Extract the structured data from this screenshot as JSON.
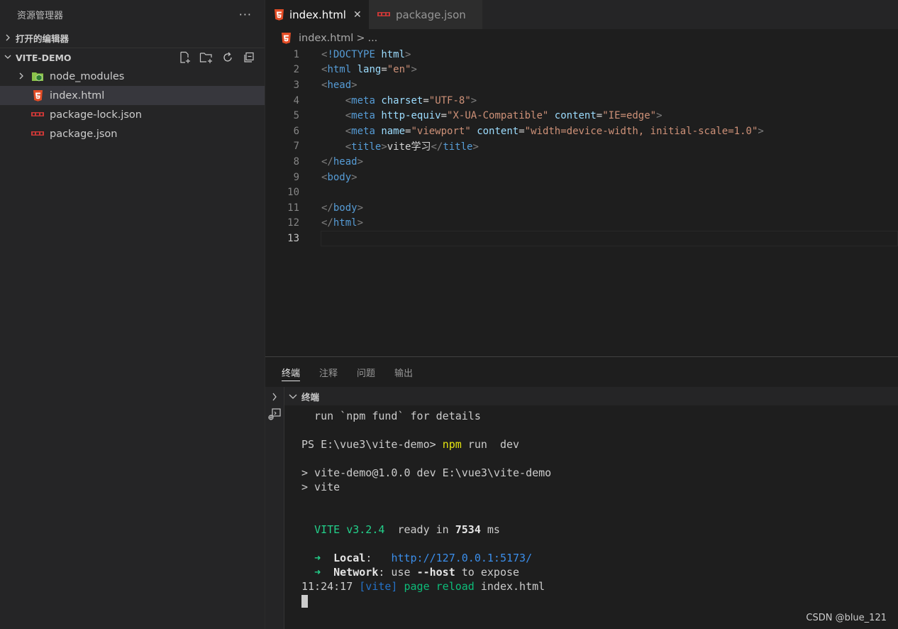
{
  "sidebar": {
    "title": "资源管理器",
    "more": "···",
    "open_editors": "打开的编辑器",
    "project": "VITE-DEMO",
    "items": [
      {
        "label": "node_modules",
        "icon": "node-modules-folder-icon"
      },
      {
        "label": "index.html",
        "icon": "html5-icon"
      },
      {
        "label": "package-lock.json",
        "icon": "npm-icon"
      },
      {
        "label": "package.json",
        "icon": "npm-icon"
      }
    ]
  },
  "editor": {
    "tabs": [
      {
        "label": "index.html",
        "close": "✕"
      },
      {
        "label": "package.json"
      }
    ],
    "breadcrumb": {
      "file": "index.html",
      "sep": ">",
      "more": "..."
    },
    "line_numbers": [
      "1",
      "2",
      "3",
      "4",
      "5",
      "6",
      "7",
      "8",
      "9",
      "10",
      "11",
      "12",
      "13"
    ],
    "lines": [
      [
        [
          "t-br",
          "<"
        ],
        [
          "t-tag",
          "!DOCTYPE"
        ],
        [
          "t-txt",
          " "
        ],
        [
          "t-attr",
          "html"
        ],
        [
          "t-br",
          ">"
        ]
      ],
      [
        [
          "t-br",
          "<"
        ],
        [
          "t-tag",
          "html"
        ],
        [
          "t-txt",
          " "
        ],
        [
          "t-attr",
          "lang"
        ],
        [
          "t-txt",
          "="
        ],
        [
          "t-str",
          "\"en\""
        ],
        [
          "t-br",
          ">"
        ]
      ],
      [
        [
          "t-br",
          "<"
        ],
        [
          "t-tag",
          "head"
        ],
        [
          "t-br",
          ">"
        ]
      ],
      [
        [
          "t-txt",
          "    "
        ],
        [
          "t-br",
          "<"
        ],
        [
          "t-tag",
          "meta"
        ],
        [
          "t-txt",
          " "
        ],
        [
          "t-attr",
          "charset"
        ],
        [
          "t-txt",
          "="
        ],
        [
          "t-str",
          "\"UTF-8\""
        ],
        [
          "t-br",
          ">"
        ]
      ],
      [
        [
          "t-txt",
          "    "
        ],
        [
          "t-br",
          "<"
        ],
        [
          "t-tag",
          "meta"
        ],
        [
          "t-txt",
          " "
        ],
        [
          "t-attr",
          "http-equiv"
        ],
        [
          "t-txt",
          "="
        ],
        [
          "t-str",
          "\"X-UA-Compatible\""
        ],
        [
          "t-txt",
          " "
        ],
        [
          "t-attr",
          "content"
        ],
        [
          "t-txt",
          "="
        ],
        [
          "t-str",
          "\"IE=edge\""
        ],
        [
          "t-br",
          ">"
        ]
      ],
      [
        [
          "t-txt",
          "    "
        ],
        [
          "t-br",
          "<"
        ],
        [
          "t-tag",
          "meta"
        ],
        [
          "t-txt",
          " "
        ],
        [
          "t-attr",
          "name"
        ],
        [
          "t-txt",
          "="
        ],
        [
          "t-str",
          "\"viewport\""
        ],
        [
          "t-txt",
          " "
        ],
        [
          "t-attr",
          "content"
        ],
        [
          "t-txt",
          "="
        ],
        [
          "t-str",
          "\"width=device-width, initial-scale=1.0\""
        ],
        [
          "t-br",
          ">"
        ]
      ],
      [
        [
          "t-txt",
          "    "
        ],
        [
          "t-br",
          "<"
        ],
        [
          "t-tag",
          "title"
        ],
        [
          "t-br",
          ">"
        ],
        [
          "t-txt",
          "vite学习"
        ],
        [
          "t-br",
          "</"
        ],
        [
          "t-tag",
          "title"
        ],
        [
          "t-br",
          ">"
        ]
      ],
      [
        [
          "t-br",
          "</"
        ],
        [
          "t-tag",
          "head"
        ],
        [
          "t-br",
          ">"
        ]
      ],
      [
        [
          "t-br",
          "<"
        ],
        [
          "t-tag",
          "body"
        ],
        [
          "t-br",
          ">"
        ]
      ],
      [],
      [
        [
          "t-br",
          "</"
        ],
        [
          "t-tag",
          "body"
        ],
        [
          "t-br",
          ">"
        ]
      ],
      [
        [
          "t-br",
          "</"
        ],
        [
          "t-tag",
          "html"
        ],
        [
          "t-br",
          ">"
        ]
      ],
      []
    ]
  },
  "panel": {
    "tabs": [
      "终端",
      "注释",
      "问题",
      "输出"
    ],
    "terminal_title": "终端",
    "terminal_lines": [
      [
        [
          "",
          "  run `npm fund` for details"
        ]
      ],
      [],
      [
        [
          "",
          "PS E:\\vue3\\vite-demo> "
        ],
        [
          "c-y",
          "npm"
        ],
        [
          "",
          " run  dev"
        ]
      ],
      [],
      [
        [
          "",
          "> vite-demo@1.0.0 dev E:\\vue3\\vite-demo"
        ]
      ],
      [
        [
          "",
          "> vite"
        ]
      ],
      [],
      [],
      [
        [
          "",
          "  "
        ],
        [
          "c-g",
          "VITE v3.2.4"
        ],
        [
          "",
          "  ready in "
        ],
        [
          "c-w",
          "7534"
        ],
        [
          "",
          " ms"
        ]
      ],
      [],
      [
        [
          "",
          "  "
        ],
        [
          "c-g",
          "➜"
        ],
        [
          "",
          "  "
        ],
        [
          "c-w",
          "Local"
        ],
        [
          "",
          ":   "
        ],
        [
          "c-b",
          "http://127.0.0.1:5173/"
        ]
      ],
      [
        [
          "",
          "  "
        ],
        [
          "c-g",
          "➜"
        ],
        [
          "",
          "  "
        ],
        [
          "c-w",
          "Network"
        ],
        [
          "",
          ": use "
        ],
        [
          "c-w",
          "--host"
        ],
        [
          "",
          " to expose"
        ]
      ],
      [
        [
          "",
          "11:24:17 "
        ],
        [
          "c-bd",
          "[vite]"
        ],
        [
          "c-gd",
          " page reload"
        ],
        [
          "",
          " index.html"
        ]
      ]
    ]
  },
  "watermark": "CSDN @blue_121"
}
